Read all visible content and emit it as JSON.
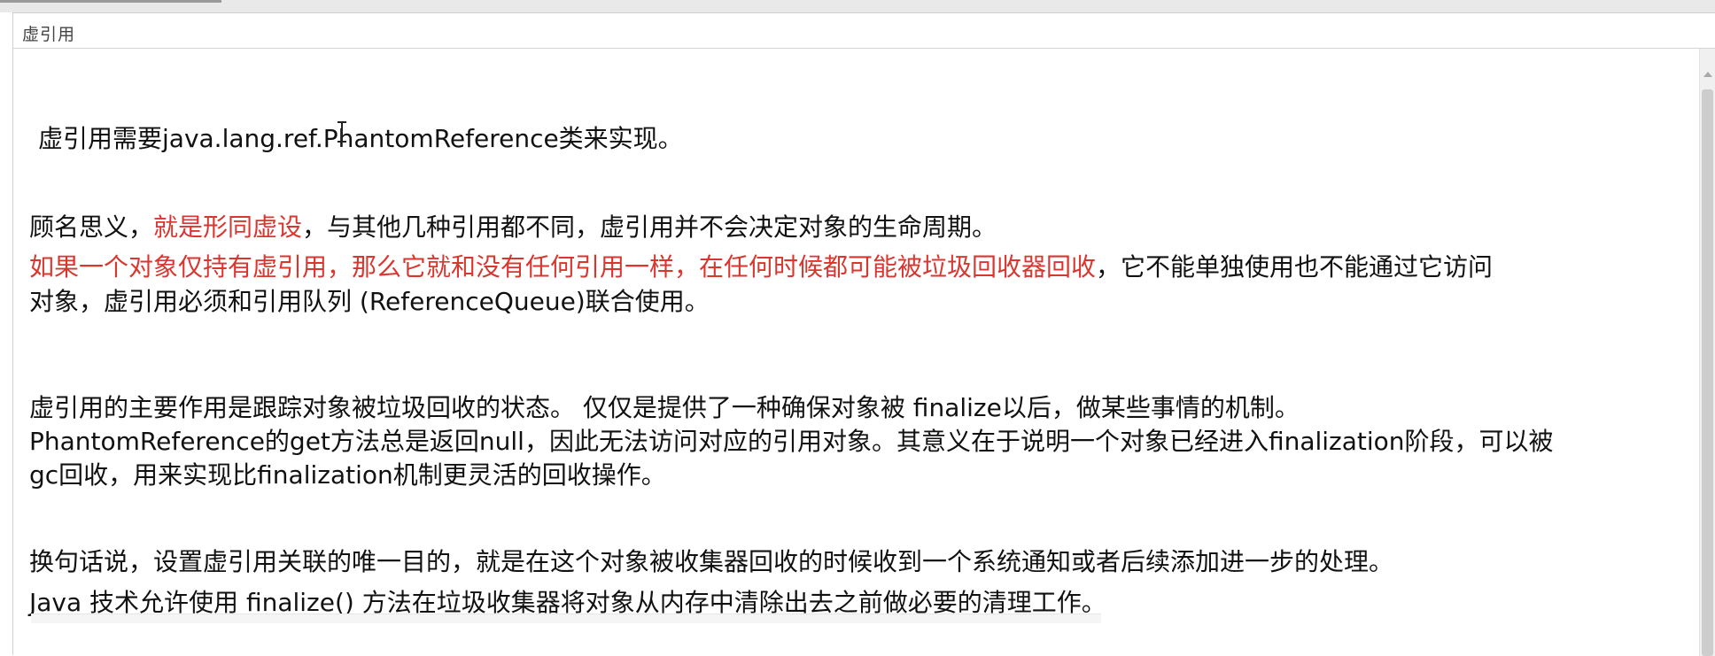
{
  "window": {
    "title": "虚引用"
  },
  "content": {
    "p1": "虚引用需要java.lang.ref.PhantomReference类来实现。",
    "p2": {
      "a": "顾名思义，",
      "b_red": "就是形同虚设",
      "c": "，与其他几种引用都不同，虚引用并不会决定对象的生命周期。"
    },
    "p3": {
      "a_red": "如果一个对象仅持有虚引用，那么它就和没有任何引用一样，在任何时候都可能被垃圾回收器回收",
      "b": "，它不能单独使用也不能通过它访问",
      "line2": "对象，虚引用必须和引用队列 (ReferenceQueue)联合使用。"
    },
    "p4": "虚引用的主要作用是跟踪对象被垃圾回收的状态。 仅仅是提供了一种确保对象被 finalize以后，做某些事情的机制。",
    "p5_line1": " PhantomReference的get方法总是返回null，因此无法访问对应的引用对象。其意义在于说明一个对象已经进入finalization阶段，可以被",
    "p5_line2": "gc回收，用来实现比finalization机制更灵活的回收操作。",
    "p6": "换句话说，设置虚引用关联的唯一目的，就是在这个对象被收集器回收的时候收到一个系统通知或者后续添加进一步的处理。",
    "p7": "Java 技术允许使用 finalize() 方法在垃圾收集器将对象从内存中清除出去之前做必要的清理工作。"
  },
  "colors": {
    "emphasis": "#d9362f",
    "text": "#111111"
  },
  "icons": {
    "cursor": "text-cursor-icon"
  }
}
